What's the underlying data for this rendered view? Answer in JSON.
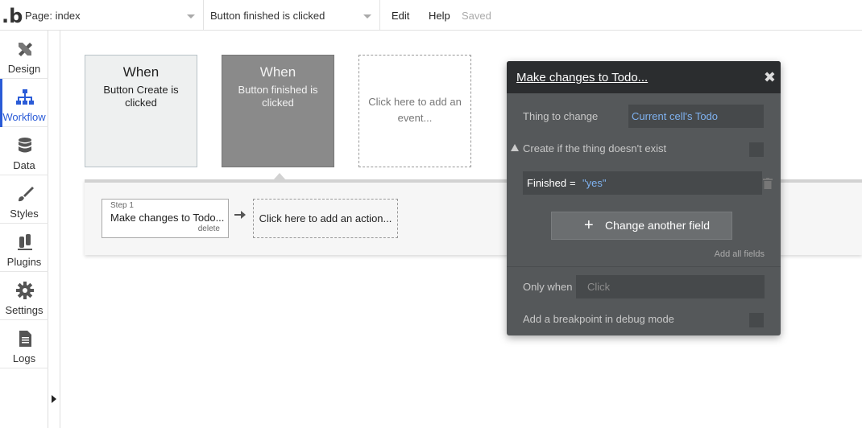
{
  "topbar": {
    "logo": ".b",
    "page_dropdown": "Page: index",
    "workflow_dropdown": "Button finished is clicked",
    "menu_edit": "Edit",
    "menu_help": "Help",
    "status": "Saved"
  },
  "sidebar": {
    "items": [
      {
        "label": "Design",
        "icon": "design-icon"
      },
      {
        "label": "Workflow",
        "icon": "workflow-icon",
        "active": true
      },
      {
        "label": "Data",
        "icon": "database-icon"
      },
      {
        "label": "Styles",
        "icon": "brush-icon"
      },
      {
        "label": "Plugins",
        "icon": "plug-icon"
      },
      {
        "label": "Settings",
        "icon": "gear-icon"
      },
      {
        "label": "Logs",
        "icon": "document-icon"
      }
    ],
    "accent": "#2a5bd7"
  },
  "events": [
    {
      "title": "When",
      "subtitle": "Button Create is clicked"
    },
    {
      "title": "When",
      "subtitle": "Button finished is clicked"
    },
    {
      "placeholder": "Click here to add an event..."
    }
  ],
  "actions": {
    "step_label": "Step 1",
    "step_title": "Make changes to Todo...",
    "step_delete": "delete",
    "add_action": "Click here to add an action..."
  },
  "panel": {
    "title": "Make changes to Todo...",
    "thing_label": "Thing to change",
    "thing_value": "Current cell's Todo",
    "create_label": "Create if the thing doesn't exist",
    "field_name": "Finished",
    "field_op": "=",
    "field_value": "\"yes\"",
    "change_button": "Change another field",
    "add_all": "Add all fields",
    "only_when_label": "Only when",
    "only_when_value": "Click",
    "breakpoint_label": "Add a breakpoint in debug mode",
    "link_color": "#7fb2f0"
  }
}
